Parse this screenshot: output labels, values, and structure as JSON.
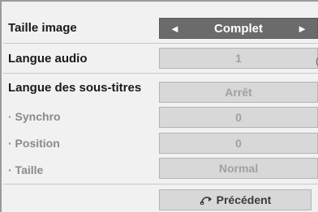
{
  "menu": {
    "rows": [
      {
        "label": "Taille image",
        "value": "Complet"
      },
      {
        "label": "Langue audio",
        "value": "1"
      },
      {
        "label": "Langue des sous-titres",
        "value": "Arrêt"
      },
      {
        "label": "· Synchro",
        "value": "0"
      },
      {
        "label": "· Position",
        "value": "0"
      },
      {
        "label": "· Taille",
        "value": "Normal"
      }
    ],
    "back_label": "Précédent",
    "prev_arrow": "◄",
    "next_arrow": "►",
    "cut_off_char": "("
  },
  "icons": {
    "back": "return-arrow-icon"
  },
  "colors": {
    "selected_value_bg": "#6b6b6b",
    "value_bg": "#d8d8d8",
    "panel_bg": "#f1f1f1",
    "label_text": "#1a1a1a",
    "disabled_label_text": "#8a8a8a"
  }
}
